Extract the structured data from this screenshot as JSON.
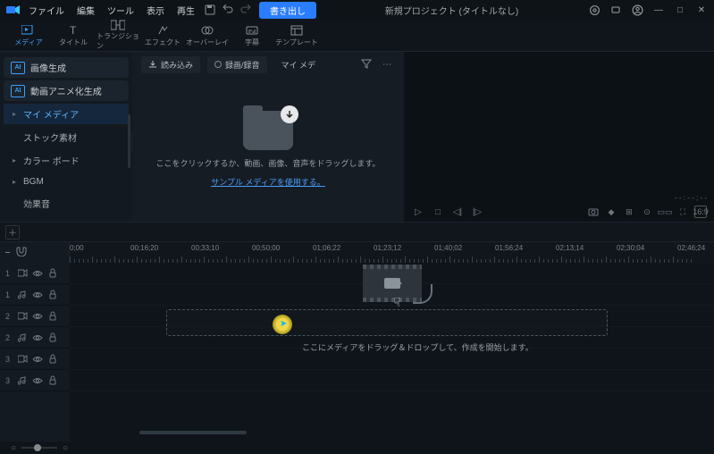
{
  "menubar": {
    "items": [
      "ファイル",
      "編集",
      "ツール",
      "表示",
      "再生"
    ],
    "export_label": "書き出し",
    "title": "新規プロジェクト (タイトルなし)"
  },
  "tabs": [
    {
      "label": "メディア"
    },
    {
      "label": "タイトル"
    },
    {
      "label": "トランジション"
    },
    {
      "label": "エフェクト"
    },
    {
      "label": "オーバーレイ"
    },
    {
      "label": "字幕"
    },
    {
      "label": "テンプレート"
    }
  ],
  "sidebar": {
    "ai_image": "画像生成",
    "ai_video": "動画アニメ化生成",
    "items": [
      {
        "label": "マイ メディア",
        "selected": true,
        "caret": "▸"
      },
      {
        "label": "ストック素材",
        "caret": ""
      },
      {
        "label": "カラー ボード",
        "caret": "▸"
      },
      {
        "label": "BGM",
        "caret": "▸"
      },
      {
        "label": "効果音",
        "caret": ""
      }
    ]
  },
  "media_toolbar": {
    "import": "読み込み",
    "record": "録画/録音",
    "mymedia": "マイ メデ"
  },
  "dropzone": {
    "text": "ここをクリックするか、動画、画像、音声をドラッグします。",
    "link": "サンプル メディアを使用する。"
  },
  "preview": {
    "timecode": "- - : - - ; - -"
  },
  "ruler": {
    "marks": [
      "0;00",
      "00;16;20",
      "00;33;10",
      "00;50;00",
      "01;06;22",
      "01;23;12",
      "01;40;02",
      "01;56;24",
      "02;13;14",
      "02;30;04",
      "02;46;24"
    ]
  },
  "tracks": [
    {
      "num": "1",
      "type": "video"
    },
    {
      "num": "1",
      "type": "audio"
    },
    {
      "num": "2",
      "type": "video"
    },
    {
      "num": "2",
      "type": "audio"
    },
    {
      "num": "3",
      "type": "video"
    },
    {
      "num": "3",
      "type": "audio"
    }
  ],
  "timeline": {
    "drop_text": "ここにメディアをドラッグ＆ドロップして、作成を開始します。"
  },
  "ai_badge": "AI"
}
